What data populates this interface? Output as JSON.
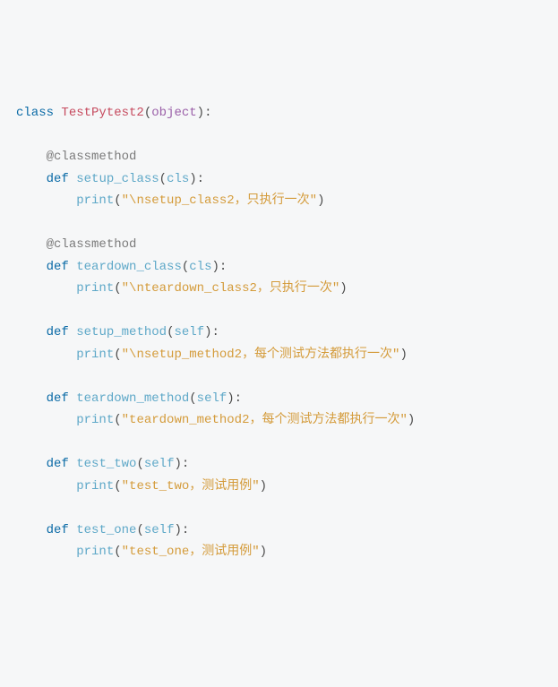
{
  "code": {
    "l1": {
      "kw1": "class",
      "cls": "TestPytest2",
      "p1": "(",
      "bi": "object",
      "p2": "):"
    },
    "l2": "",
    "l3": {
      "dec": "@classmethod"
    },
    "l4": {
      "kw": "def",
      "fn": "setup_class",
      "p1": "(",
      "arg": "cls",
      "p2": "):"
    },
    "l5": {
      "fn": "print",
      "p1": "(",
      "str": "\"\\nsetup_class2，只执行一次\"",
      "p2": ")"
    },
    "l6": "",
    "l7": {
      "dec": "@classmethod"
    },
    "l8": {
      "kw": "def",
      "fn": "teardown_class",
      "p1": "(",
      "arg": "cls",
      "p2": "):"
    },
    "l9": {
      "fn": "print",
      "p1": "(",
      "str": "\"\\nteardown_class2，只执行一次\"",
      "p2": ")"
    },
    "l10": "",
    "l11": {
      "kw": "def",
      "fn": "setup_method",
      "p1": "(",
      "arg": "self",
      "p2": "):"
    },
    "l12": {
      "fn": "print",
      "p1": "(",
      "str": "\"\\nsetup_method2，每个测试方法都执行一次\"",
      "p2": ")"
    },
    "l13": "",
    "l14": {
      "kw": "def",
      "fn": "teardown_method",
      "p1": "(",
      "arg": "self",
      "p2": "):"
    },
    "l15": {
      "fn": "print",
      "p1": "(",
      "str": "\"teardown_method2，每个测试方法都执行一次\"",
      "p2": ")"
    },
    "l16": "",
    "l17": {
      "kw": "def",
      "fn": "test_two",
      "p1": "(",
      "arg": "self",
      "p2": "):"
    },
    "l18": {
      "fn": "print",
      "p1": "(",
      "str": "\"test_two，测试用例\"",
      "p2": ")"
    },
    "l19": "",
    "l20": {
      "kw": "def",
      "fn": "test_one",
      "p1": "(",
      "arg": "self",
      "p2": "):"
    },
    "l21": {
      "fn": "print",
      "p1": "(",
      "str": "\"test_one，测试用例\"",
      "p2": ")"
    }
  }
}
